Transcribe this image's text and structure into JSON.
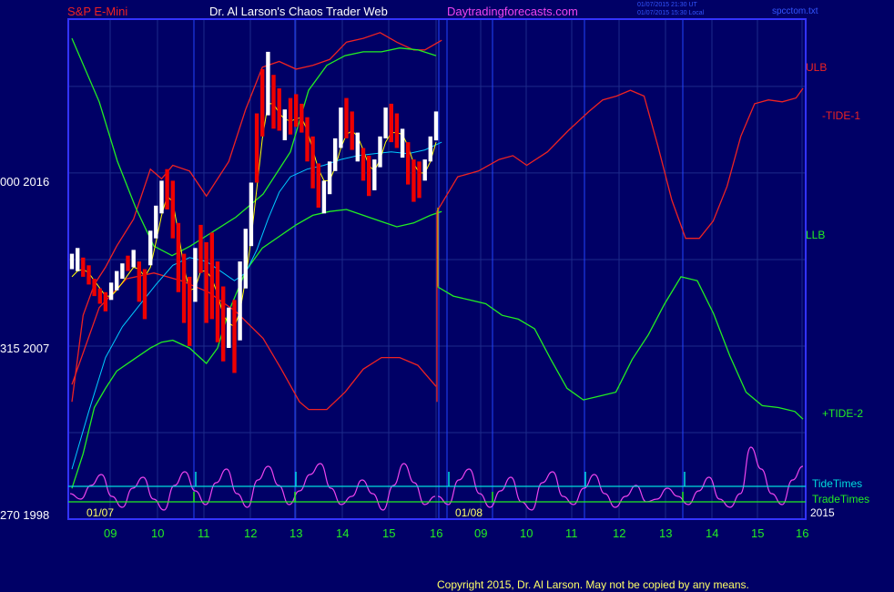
{
  "header": {
    "instrument": "S&P E-Mini",
    "site": "Dr. Al Larson's Chaos Trader Web",
    "url": "Daytradingforecasts.com",
    "stamp_utc": "01/07/2015 21:30 UT",
    "stamp_local": "01/07/2015 15:30 Local",
    "file": "spcctom.txt"
  },
  "footer": {
    "copyright": "Copyright 2015, Dr. Al Larson. May not be copied by any means."
  },
  "colors": {
    "background": "#000066",
    "frame": "#3333ff",
    "gridline": "#1c2a8a",
    "price_bar_up": "#ffffff",
    "price_bar_down": "#ee0000",
    "ulb": "#ee2222",
    "llb": "#22ee22",
    "tide_minus_1": "#ee2222",
    "tide_plus_2": "#22ee22",
    "mavg_fast": "#ffff00",
    "mavg_slow": "#00ccff",
    "energy": "#ee44ee",
    "tide_times": "#00dddd",
    "trade_times": "#22ee22"
  },
  "chart_data": {
    "type": "line",
    "title": "S&P E-Mini",
    "y_axis_labels": [
      {
        "price": 2016,
        "label": "000  2016"
      },
      {
        "price": 2007,
        "label": "315  2007"
      },
      {
        "price": 1998,
        "label": "270  1998"
      }
    ],
    "ylim": [
      1998,
      2024
    ],
    "x_ticks": [
      "09",
      "10",
      "11",
      "12",
      "13",
      "14",
      "15",
      "16",
      "09",
      "10",
      "11",
      "12",
      "13",
      "14",
      "15",
      "16"
    ],
    "dates": [
      "01/07",
      "01/08"
    ],
    "year": "2015",
    "series_labels": [
      "ULB",
      "-TIDE-1",
      "LLB",
      "+TIDE-2",
      "TideTimes",
      "TradeTimes"
    ],
    "price_bars": [
      [
        2011.8,
        2011.0
      ],
      [
        2012.1,
        2010.9
      ],
      [
        2011.6,
        2010.6
      ],
      [
        2011.2,
        2010.2
      ],
      [
        2010.5,
        2009.6
      ],
      [
        2010.0,
        2009.2
      ],
      [
        2009.8,
        2008.8
      ],
      [
        2010.3,
        2009.4
      ],
      [
        2010.9,
        2009.9
      ],
      [
        2011.3,
        2010.5
      ],
      [
        2011.7,
        2010.9
      ],
      [
        2012.0,
        2011.1
      ],
      [
        2011.4,
        2009.3
      ],
      [
        2011.0,
        2008.4
      ],
      [
        2013.0,
        2011.2
      ],
      [
        2014.3,
        2012.6
      ],
      [
        2015.6,
        2013.9
      ],
      [
        2016.2,
        2014.1
      ],
      [
        2015.6,
        2012.6
      ],
      [
        2013.4,
        2009.8
      ],
      [
        2011.8,
        2008.2
      ],
      [
        2010.6,
        2007.0
      ],
      [
        2012.1,
        2009.3
      ],
      [
        2013.3,
        2010.8
      ],
      [
        2012.4,
        2008.2
      ],
      [
        2012.9,
        2008.4
      ],
      [
        2011.4,
        2007.2
      ],
      [
        2010.1,
        2006.2
      ],
      [
        2009.0,
        2006.9
      ],
      [
        2009.4,
        2005.6
      ],
      [
        2011.4,
        2007.3
      ],
      [
        2013.1,
        2010.0
      ],
      [
        2015.5,
        2012.2
      ],
      [
        2019.1,
        2015.5
      ],
      [
        2021.4,
        2017.9
      ],
      [
        2022.3,
        2019.0
      ],
      [
        2021.1,
        2018.3
      ],
      [
        2020.4,
        2018.2
      ],
      [
        2019.3,
        2017.7
      ],
      [
        2019.9,
        2018.0
      ],
      [
        2020.1,
        2018.4
      ],
      [
        2019.6,
        2018.1
      ],
      [
        2018.9,
        2016.6
      ],
      [
        2017.9,
        2015.2
      ],
      [
        2016.5,
        2014.2
      ],
      [
        2015.6,
        2013.9
      ],
      [
        2016.6,
        2014.9
      ],
      [
        2017.8,
        2016.1
      ],
      [
        2019.4,
        2017.3
      ],
      [
        2019.9,
        2017.8
      ],
      [
        2019.2,
        2017.2
      ],
      [
        2018.1,
        2016.6
      ],
      [
        2017.3,
        2015.6
      ],
      [
        2016.9,
        2014.8
      ],
      [
        2016.7,
        2015.1
      ],
      [
        2017.9,
        2016.3
      ],
      [
        2019.4,
        2017.8
      ],
      [
        2019.6,
        2017.6
      ],
      [
        2019.1,
        2017.3
      ],
      [
        2018.3,
        2016.8
      ],
      [
        2017.6,
        2015.4
      ],
      [
        2016.7,
        2014.5
      ],
      [
        2016.6,
        2014.7
      ],
      [
        2016.7,
        2015.6
      ],
      [
        2017.9,
        2016.6
      ],
      [
        2019.2,
        2017.7
      ]
    ],
    "price_close": [
      2011.4,
      2011.5,
      2011.0,
      2010.6,
      2010.0,
      2009.5,
      2009.2,
      2009.9,
      2010.5,
      2010.9,
      2011.3,
      2011.6,
      2009.9,
      2009.4,
      2012.1,
      2013.5,
      2014.8,
      2014.9,
      2013.3,
      2010.9,
      2009.3,
      2007.9,
      2010.9,
      2011.7,
      2009.1,
      2009.6,
      2008.1,
      2007.0,
      2008.2,
      2006.7,
      2009.5,
      2012.0,
      2014.5,
      2017.2,
      2019.4,
      2020.7,
      2019.0,
      2018.9,
      2018.5,
      2018.7,
      2019.1,
      2018.8,
      2017.3,
      2016.3,
      2015.0,
      2014.8,
      2015.9,
      2017.0,
      2018.4,
      2018.5,
      2018.0,
      2017.4,
      2016.2,
      2015.6,
      2016.0,
      2017.5,
      2018.6,
      2018.3,
      2017.9,
      2017.7,
      2016.3,
      2015.2,
      2015.5,
      2016.2,
      2017.4,
      2018.9
    ],
    "ulb_series": [
      [
        0,
        2004.1
      ],
      [
        2,
        2008.6
      ],
      [
        4,
        2010.2
      ],
      [
        6,
        2011.1
      ],
      [
        8,
        2012.2
      ],
      [
        11,
        2013.6
      ],
      [
        14,
        2016.2
      ],
      [
        16,
        2015.7
      ],
      [
        18,
        2016.4
      ],
      [
        21,
        2016.1
      ],
      [
        24,
        2014.8
      ],
      [
        28,
        2016.6
      ],
      [
        31,
        2019.3
      ],
      [
        34,
        2021.5
      ],
      [
        37,
        2021.8
      ],
      [
        40,
        2021.4
      ],
      [
        43,
        2021.6
      ],
      [
        46,
        2021.9
      ],
      [
        49,
        2022.8
      ],
      [
        52,
        2023.0
      ],
      [
        55,
        2023.3
      ],
      [
        58,
        2022.8
      ],
      [
        61,
        2022.4
      ],
      [
        63,
        2022.4
      ],
      [
        66,
        2022.9
      ]
    ],
    "llb_series": [
      [
        0,
        1999.6
      ],
      [
        2,
        2001.4
      ],
      [
        4,
        2003.8
      ],
      [
        6,
        2004.8
      ],
      [
        8,
        2005.7
      ],
      [
        11,
        2006.3
      ],
      [
        14,
        2006.9
      ],
      [
        16,
        2007.2
      ],
      [
        18,
        2007.3
      ],
      [
        21,
        2006.9
      ],
      [
        24,
        2006.1
      ],
      [
        26,
        2006.9
      ],
      [
        28,
        2008.8
      ],
      [
        31,
        2010.9
      ],
      [
        34,
        2012.1
      ],
      [
        37,
        2012.7
      ],
      [
        40,
        2013.3
      ],
      [
        43,
        2013.8
      ],
      [
        46,
        2014.0
      ],
      [
        49,
        2014.1
      ],
      [
        52,
        2013.8
      ],
      [
        55,
        2013.5
      ],
      [
        58,
        2013.2
      ],
      [
        61,
        2013.4
      ],
      [
        64,
        2013.8
      ],
      [
        66,
        2014.0
      ]
    ],
    "mavg_fast": [
      2010.6,
      2010.9,
      2011.0,
      2010.8,
      2010.4,
      2010.0,
      2009.6,
      2009.6,
      2009.9,
      2010.3,
      2010.7,
      2011.1,
      2011.0,
      2010.6,
      2011.1,
      2012.4,
      2013.8,
      2014.8,
      2014.5,
      2012.9,
      2011.1,
      2009.9,
      2010.0,
      2010.9,
      2010.9,
      2010.5,
      2009.7,
      2008.6,
      2008.2,
      2008.0,
      2008.8,
      2010.5,
      2012.6,
      2015.2,
      2017.8,
      2019.6,
      2019.6,
      2019.1,
      2018.8,
      2018.7,
      2018.8,
      2018.9,
      2018.2,
      2017.2,
      2016.2,
      2015.6,
      2015.6,
      2016.3,
      2017.3,
      2018.0,
      2018.2,
      2017.9,
      2017.2,
      2016.4,
      2016.1,
      2016.7,
      2017.6,
      2018.1,
      2018.1,
      2018.0,
      2017.4,
      2016.5,
      2016.0,
      2016.0,
      2016.6,
      2017.6
    ],
    "mavg_slow": [
      [
        0,
        2000.6
      ],
      [
        3,
        2003.6
      ],
      [
        6,
        2006.4
      ],
      [
        9,
        2008.0
      ],
      [
        12,
        2009.1
      ],
      [
        15,
        2010.2
      ],
      [
        18,
        2011.2
      ],
      [
        21,
        2011.6
      ],
      [
        24,
        2011.4
      ],
      [
        27,
        2010.8
      ],
      [
        29,
        2010.4
      ],
      [
        31,
        2010.8
      ],
      [
        33,
        2012.0
      ],
      [
        35,
        2013.6
      ],
      [
        37,
        2015.0
      ],
      [
        39,
        2015.8
      ],
      [
        42,
        2016.2
      ],
      [
        45,
        2016.4
      ],
      [
        48,
        2016.7
      ],
      [
        51,
        2016.9
      ],
      [
        54,
        2017.0
      ],
      [
        57,
        2017.1
      ],
      [
        60,
        2017.0
      ],
      [
        63,
        2017.2
      ],
      [
        66,
        2017.6
      ]
    ],
    "proj_upper": [
      [
        0,
        2014.0
      ],
      [
        3,
        2015.8
      ],
      [
        6,
        2016.1
      ],
      [
        9,
        2016.7
      ],
      [
        11,
        2016.9
      ],
      [
        13,
        2016.4
      ],
      [
        16,
        2017.1
      ],
      [
        19,
        2018.2
      ],
      [
        22,
        2019.2
      ],
      [
        24,
        2019.8
      ],
      [
        26,
        2020.0
      ],
      [
        28,
        2020.3
      ],
      [
        30,
        2020.0
      ],
      [
        32,
        2017.4
      ],
      [
        34,
        2014.6
      ],
      [
        36,
        2012.6
      ],
      [
        38,
        2012.6
      ],
      [
        40,
        2013.5
      ],
      [
        42,
        2015.3
      ],
      [
        44,
        2017.9
      ],
      [
        46,
        2019.6
      ],
      [
        48,
        2019.8
      ],
      [
        50,
        2019.7
      ],
      [
        52,
        2019.9
      ],
      [
        53,
        2020.4
      ]
    ],
    "proj_lower": [
      [
        0,
        2010.1
      ],
      [
        2,
        2009.6
      ],
      [
        4,
        2009.4
      ],
      [
        6,
        2009.2
      ],
      [
        8,
        2008.6
      ],
      [
        10,
        2008.4
      ],
      [
        12,
        2007.9
      ],
      [
        14,
        2006.3
      ],
      [
        16,
        2004.8
      ],
      [
        18,
        2004.2
      ],
      [
        20,
        2004.4
      ],
      [
        22,
        2004.6
      ],
      [
        24,
        2006.3
      ],
      [
        26,
        2007.6
      ],
      [
        28,
        2009.2
      ],
      [
        30,
        2010.6
      ],
      [
        32,
        2010.4
      ],
      [
        34,
        2008.7
      ],
      [
        36,
        2006.5
      ],
      [
        38,
        2004.6
      ],
      [
        40,
        2003.9
      ],
      [
        42,
        2003.8
      ],
      [
        44,
        2003.6
      ],
      [
        45,
        2003.2
      ]
    ],
    "tide_left_red": [
      [
        0,
        2005.0
      ],
      [
        3,
        2009.0
      ],
      [
        6,
        2010.5
      ],
      [
        9,
        2010.8
      ],
      [
        12,
        2010.4
      ],
      [
        15,
        2009.8
      ],
      [
        18,
        2008.8
      ],
      [
        21,
        2007.4
      ],
      [
        23,
        2005.8
      ],
      [
        25,
        2004.1
      ],
      [
        26,
        2003.7
      ],
      [
        28,
        2003.7
      ],
      [
        30,
        2004.6
      ],
      [
        32,
        2005.8
      ],
      [
        34,
        2006.4
      ],
      [
        36,
        2006.4
      ],
      [
        38,
        2006.0
      ],
      [
        40,
        2004.9
      ]
    ],
    "tide_left_green": [
      [
        0,
        2023.0
      ],
      [
        3,
        2019.7
      ],
      [
        5,
        2016.6
      ],
      [
        7,
        2014.2
      ],
      [
        9,
        2012.2
      ],
      [
        11,
        2011.7
      ],
      [
        13,
        2012.2
      ],
      [
        15,
        2012.8
      ],
      [
        18,
        2013.7
      ],
      [
        21,
        2014.9
      ],
      [
        24,
        2017.1
      ],
      [
        26,
        2020.3
      ],
      [
        28,
        2021.6
      ],
      [
        30,
        2022.1
      ],
      [
        32,
        2022.3
      ],
      [
        34,
        2022.3
      ],
      [
        36,
        2022.5
      ],
      [
        38,
        2022.4
      ],
      [
        40,
        2022.1
      ]
    ],
    "energy_left": [
      0.4,
      0.3,
      0.55,
      0.75,
      0.35,
      0.15,
      0.5,
      0.7,
      0.3,
      0.1,
      0.55,
      0.8,
      0.45,
      0.2,
      0.6,
      0.85,
      0.4,
      0.15,
      0.65,
      0.9,
      0.55,
      0.2,
      0.45,
      0.75,
      0.95,
      0.5,
      0.2,
      0.35,
      0.65,
      0.4,
      0.1,
      0.55,
      0.95,
      0.6,
      0.2,
      0.35
    ],
    "energy_right": [
      0.35,
      0.2,
      0.65,
      0.85,
      0.4,
      0.15,
      0.45,
      0.7,
      0.25,
      0.1,
      0.6,
      0.8,
      0.35,
      0.2,
      0.5,
      0.75,
      0.4,
      0.15,
      0.35,
      0.55,
      0.25,
      0.3,
      0.5,
      0.35,
      0.2,
      0.45,
      0.7,
      0.3,
      0.15,
      0.4,
      1.25,
      0.85,
      0.4,
      0.2,
      0.65,
      0.9
    ]
  }
}
